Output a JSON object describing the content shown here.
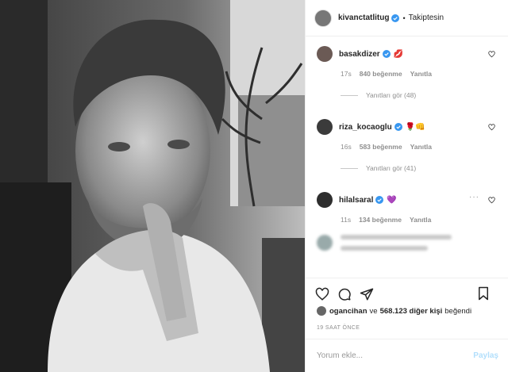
{
  "header": {
    "username": "kivanctatlitug",
    "separator": "•",
    "follow_label": "Takiptesin"
  },
  "comments": [
    {
      "username": "basakdizer",
      "emoji": "💋",
      "time": "17s",
      "likes": "840 beğenme",
      "reply": "Yanıtla",
      "view_replies": "Yanıtları gör (48)"
    },
    {
      "username": "riza_kocaoglu",
      "emoji": "🌹👊",
      "time": "16s",
      "likes": "583 beğenme",
      "reply": "Yanıtla",
      "view_replies": "Yanıtları gör (41)"
    },
    {
      "username": "hilalsaral",
      "emoji": "💜",
      "time": "11s",
      "likes": "134 beğenme",
      "reply": "Yanıtla",
      "more": "···"
    }
  ],
  "liked_by": {
    "user": "ogancihan",
    "connector": "ve",
    "others": "568.123 diğer kişi",
    "suffix": "beğendi"
  },
  "timestamp": "19 SAAT ÖNCE",
  "input": {
    "placeholder": "Yorum ekle...",
    "post_label": "Paylaş"
  },
  "icons": [
    "heart-icon",
    "comment-icon",
    "share-icon",
    "bookmark-icon",
    "verified-icon"
  ],
  "colors": {
    "verified": "#3897f0",
    "post_disabled": "#b2dffc",
    "meta": "#8e8e8e"
  }
}
